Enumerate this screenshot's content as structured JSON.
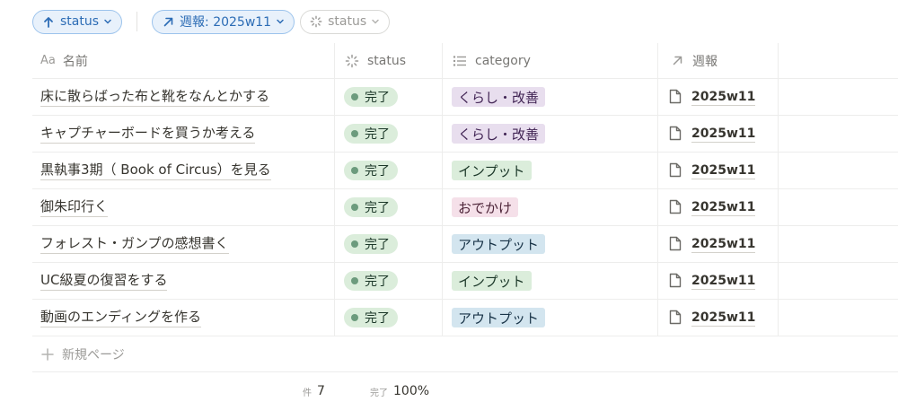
{
  "filters": {
    "sort_label": "status",
    "week_filter_label": "週報: 2025w11",
    "status_filter_label": "status"
  },
  "columns": {
    "name_icon": "Aa",
    "name": "名前",
    "status": "status",
    "category": "category",
    "week": "週報"
  },
  "rows": [
    {
      "name": "床に散らばった布と靴をなんとかする",
      "status": "完了",
      "category": "くらし・改善",
      "week": "2025w11"
    },
    {
      "name": "キャプチャーボードを買うか考える",
      "status": "完了",
      "category": "くらし・改善",
      "week": "2025w11"
    },
    {
      "name": "黒執事3期（ Book of Circus）を見る",
      "status": "完了",
      "category": "インプット",
      "week": "2025w11"
    },
    {
      "name": "御朱印行く",
      "status": "完了",
      "category": "おでかけ",
      "week": "2025w11"
    },
    {
      "name": "フォレスト・ガンプの感想書く",
      "status": "完了",
      "category": "アウトプット",
      "week": "2025w11"
    },
    {
      "name": "UC級夏の復習をする",
      "status": "完了",
      "category": "インプット",
      "week": "2025w11"
    },
    {
      "name": "動画のエンディングを作る",
      "status": "完了",
      "category": "アウトプット",
      "week": "2025w11"
    }
  ],
  "tag_colors": {
    "くらし・改善": {
      "bg": "#e8deee",
      "fg": "#412454"
    },
    "インプット": {
      "bg": "#dbeddb",
      "fg": "#1c3829"
    },
    "おでかけ": {
      "bg": "#f5e0e9",
      "fg": "#4c2337"
    },
    "アウトプット": {
      "bg": "#d3e5ef",
      "fg": "#183347"
    }
  },
  "new_page_label": "新規ページ",
  "footer": {
    "count_label": "件",
    "count_value": "7",
    "complete_label": "完了",
    "complete_value": "100%"
  },
  "colors": {
    "accent_blue": "#2c6cb5",
    "status_done_bg": "#dbeddb",
    "status_done_dot": "#6c9b7d"
  }
}
